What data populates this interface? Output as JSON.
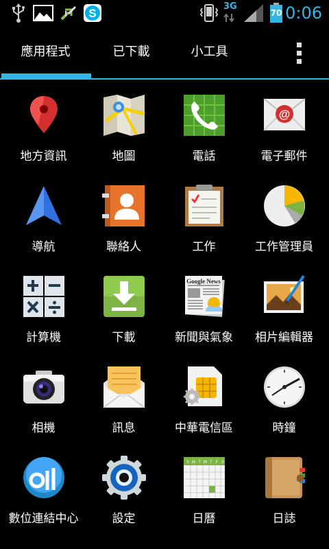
{
  "status_bar": {
    "clock": "0:06",
    "battery": "70",
    "network": "3G",
    "icons": [
      "usb-icon",
      "picture-icon",
      "sync-arrows-icon",
      "skype-icon",
      "vibrate-icon",
      "data-activity-icon",
      "signal-icon",
      "battery-icon"
    ]
  },
  "tabs": [
    {
      "label": "應用程式",
      "selected": true
    },
    {
      "label": "已下載",
      "selected": false
    },
    {
      "label": "小工具",
      "selected": false
    }
  ],
  "accent_color": "#33b5e5",
  "apps": [
    {
      "label": "地方資訊",
      "icon": "places-pin-icon"
    },
    {
      "label": "地圖",
      "icon": "maps-icon"
    },
    {
      "label": "電話",
      "icon": "phone-icon"
    },
    {
      "label": "電子郵件",
      "icon": "email-icon"
    },
    {
      "label": "導航",
      "icon": "navigation-arrow-icon"
    },
    {
      "label": "聯絡人",
      "icon": "contacts-icon"
    },
    {
      "label": "工作",
      "icon": "tasks-clipboard-icon"
    },
    {
      "label": "工作管理員",
      "icon": "task-manager-pie-icon"
    },
    {
      "label": "計算機",
      "icon": "calculator-icon"
    },
    {
      "label": "下載",
      "icon": "download-icon"
    },
    {
      "label": "新聞與氣象",
      "icon": "news-weather-icon"
    },
    {
      "label": "相片編輯器",
      "icon": "photo-editor-icon"
    },
    {
      "label": "相機",
      "icon": "camera-icon"
    },
    {
      "label": "訊息",
      "icon": "messaging-icon"
    },
    {
      "label": "中華電信區",
      "icon": "sim-gear-icon"
    },
    {
      "label": "時鐘",
      "icon": "clock-icon"
    },
    {
      "label": "數位連結中心",
      "icon": "digital-connect-icon"
    },
    {
      "label": "設定",
      "icon": "settings-gear-icon"
    },
    {
      "label": "日曆",
      "icon": "calendar-icon"
    },
    {
      "label": "日誌",
      "icon": "notebook-icon"
    }
  ],
  "calendar_days": [
    "S",
    "M",
    "T",
    "W",
    "T",
    "F",
    "S"
  ],
  "news_masthead": "Google News"
}
